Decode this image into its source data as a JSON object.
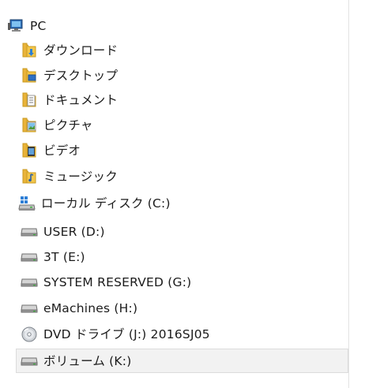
{
  "tree": {
    "root": {
      "label": "PC",
      "icon": "computer-icon"
    },
    "items": [
      {
        "label": "ダウンロード",
        "icon": "downloads-folder-icon"
      },
      {
        "label": "デスクトップ",
        "icon": "desktop-folder-icon"
      },
      {
        "label": "ドキュメント",
        "icon": "documents-folder-icon"
      },
      {
        "label": "ピクチャ",
        "icon": "pictures-folder-icon"
      },
      {
        "label": "ビデオ",
        "icon": "videos-folder-icon"
      },
      {
        "label": "ミュージック",
        "icon": "music-folder-icon"
      },
      {
        "label": "ローカル ディスク (C:)",
        "icon": "windows-drive-icon"
      },
      {
        "label": "USER (D:)",
        "icon": "drive-icon"
      },
      {
        "label": "3T (E:)",
        "icon": "drive-icon"
      },
      {
        "label": "SYSTEM RESERVED (G:)",
        "icon": "drive-icon"
      },
      {
        "label": "eMachines (H:)",
        "icon": "drive-icon"
      },
      {
        "label": "DVD ドライブ (J:) 2016SJ05",
        "icon": "dvd-drive-icon"
      },
      {
        "label": "ボリューム (K:)",
        "icon": "drive-icon",
        "selected": true
      }
    ]
  }
}
